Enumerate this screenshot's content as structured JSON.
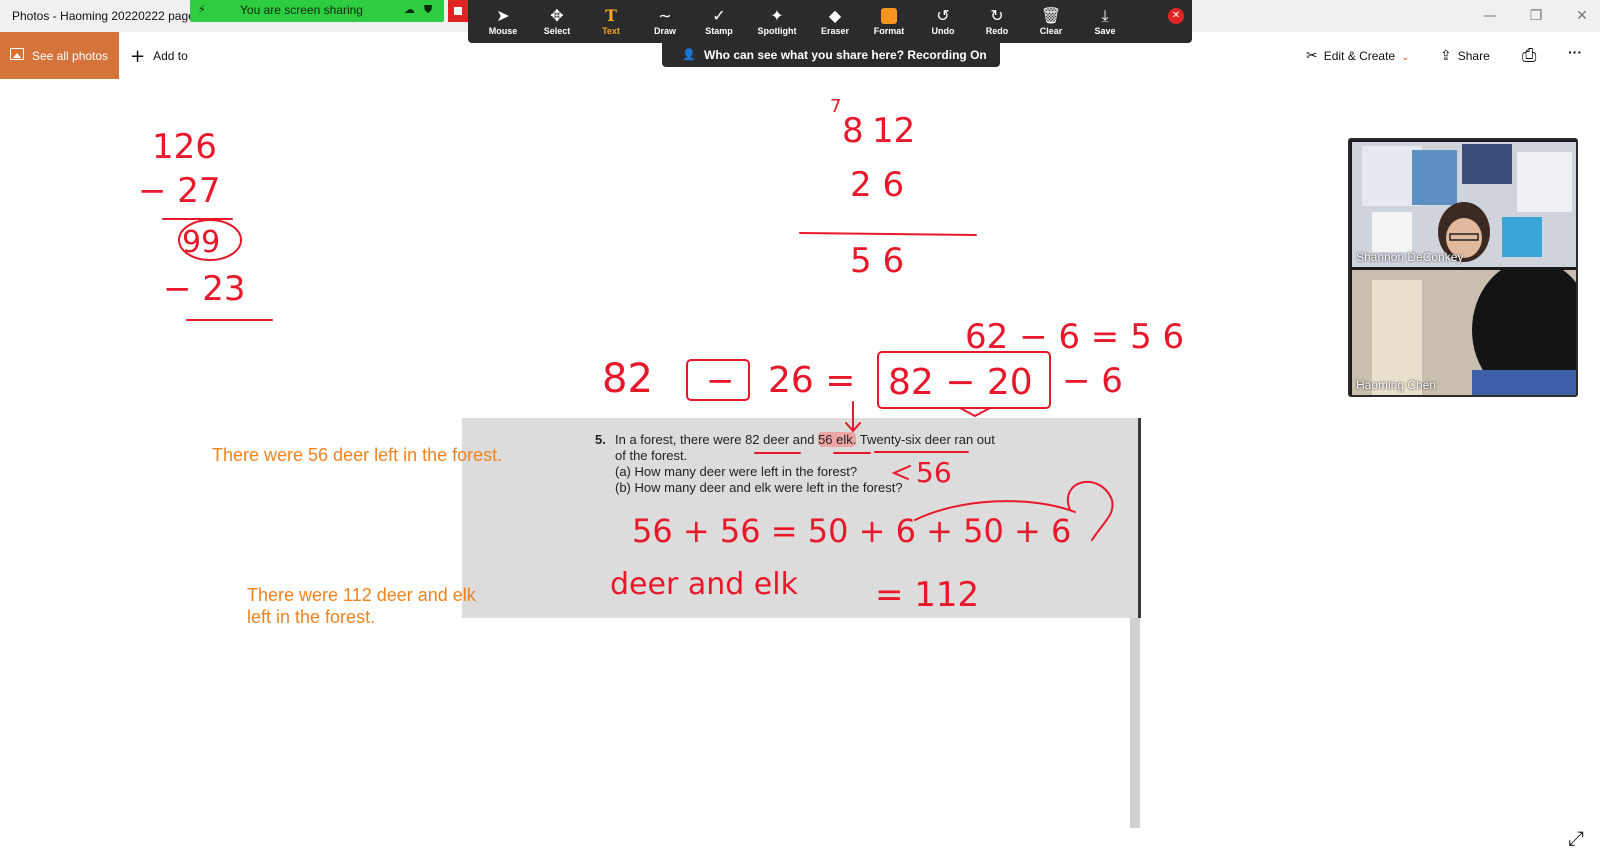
{
  "window": {
    "title": "Photos - Haoming 20220222 page",
    "minimize": "—",
    "restore": "❐",
    "close": "✕"
  },
  "share_banner": {
    "text": "You are screen sharing"
  },
  "annotation_toolbar": {
    "tools": [
      {
        "label": "Mouse",
        "icon": "➤"
      },
      {
        "label": "Select",
        "icon": "✥"
      },
      {
        "label": "Text",
        "icon": "T"
      },
      {
        "label": "Draw",
        "icon": "∼"
      },
      {
        "label": "Stamp",
        "icon": "✓"
      },
      {
        "label": "Spotlight",
        "icon": "✦"
      },
      {
        "label": "Eraser",
        "icon": "◆"
      },
      {
        "label": "Format",
        "icon": ""
      },
      {
        "label": "Undo",
        "icon": "↺"
      },
      {
        "label": "Redo",
        "icon": "↻"
      },
      {
        "label": "Clear",
        "icon": "🗑"
      },
      {
        "label": "Save",
        "icon": "⤓"
      }
    ],
    "active_tool": "Text",
    "format_color": "#f7931e",
    "close_icon": "✕"
  },
  "recording_bar": {
    "text": "Who can see what you share here? Recording On",
    "icon": "👤"
  },
  "photos_toolbar": {
    "see_all_photos": "See all photos",
    "add_to": "Add to",
    "add_icon": "+",
    "edit_create": "Edit & Create",
    "edit_icon": "✂",
    "share": "Share",
    "share_icon": "⇪",
    "print_icon": "⎙",
    "more_icon": "···",
    "chevron": "⌄"
  },
  "problem": {
    "number": "5.",
    "line1_before": "In a forest, there were 82 deer and ",
    "line1_highlight": "56 elk.",
    "line1_after": " Twenty-six deer ran out",
    "line2": "of the forest.",
    "line3": "(a)  How many deer were left in the forest?",
    "line4": "(b)  How many deer and elk were left in the forest?"
  },
  "typed_answers": {
    "answer_a": "There were 56 deer left in the forest.",
    "answer_b_line1": "There were 112 deer and elk",
    "answer_b_line2": "left in the forest."
  },
  "handwriting": {
    "top_left": [
      "126",
      "− 27",
      "99",
      "− 23"
    ],
    "top_center": [
      "7",
      "8",
      "12",
      "2 6",
      "5  6"
    ],
    "equation_right": "62  − 6 = 5 6",
    "equation_main_left": "82",
    "equation_main_op": "−",
    "equation_main_mid": "26 =",
    "equation_boxed": "82 − 20",
    "equation_main_tail": "− 6",
    "answer_a_mark": "56",
    "sum_line": "56 + 56  =  50 + 6 + 50 + 6",
    "deer_and_elk": "deer and elk",
    "equals_result": "=  112"
  },
  "participants": [
    {
      "name": "Shannon DeConkey"
    },
    {
      "name": "Haoming Chen"
    }
  ],
  "expand_icon": "⤢"
}
